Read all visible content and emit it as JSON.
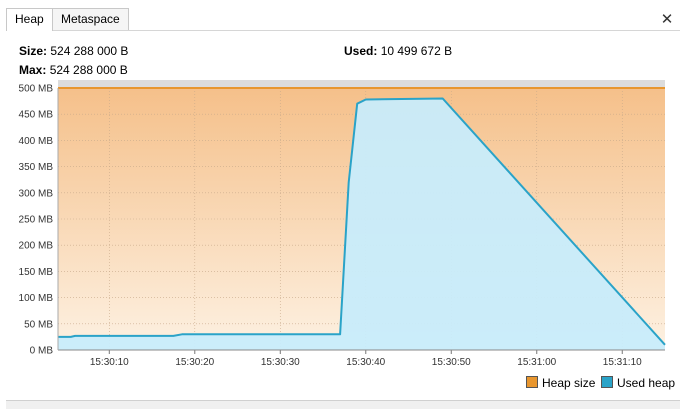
{
  "tabs": [
    {
      "label": "Heap",
      "active": true
    },
    {
      "label": "Metaspace",
      "active": false
    }
  ],
  "close_icon": "close-icon",
  "info": {
    "size_label": "Size:",
    "size_value": "524 288 000 B",
    "max_label": "Max:",
    "max_value": "524 288 000 B",
    "used_label": "Used:",
    "used_value": "10 499 672 B"
  },
  "colors": {
    "heap_size": "#e8962e",
    "used_heap": "#2aa3c8",
    "used_fill": "#c8ecfb",
    "plot_bg_top": "#f5c08a",
    "plot_bg_bottom": "#fdf1e2"
  },
  "chart_data": {
    "type": "area",
    "y_unit": "MB",
    "ylim": [
      0,
      500
    ],
    "x_range": [
      "15:30:04",
      "15:31:15"
    ],
    "y_ticks": [
      "0 MB",
      "50 MB",
      "100 MB",
      "150 MB",
      "200 MB",
      "250 MB",
      "300 MB",
      "350 MB",
      "400 MB",
      "450 MB",
      "500 MB"
    ],
    "x_ticks": [
      "15:30:10",
      "15:30:20",
      "15:30:30",
      "15:30:40",
      "15:30:50",
      "15:31:00",
      "15:31:10"
    ],
    "grid": true,
    "legend_position": "bottom-right",
    "series": [
      {
        "name": "Heap size",
        "points": [
          [
            "15:30:04",
            500
          ],
          [
            "15:31:15",
            500
          ]
        ]
      },
      {
        "name": "Used heap",
        "points": [
          [
            "15:30:04",
            25
          ],
          [
            "15:30:05.5",
            25
          ],
          [
            "15:30:06",
            27
          ],
          [
            "15:30:17.5",
            27
          ],
          [
            "15:30:18.5",
            30
          ],
          [
            "15:30:37",
            30
          ],
          [
            "15:30:38",
            320
          ],
          [
            "15:30:39",
            470
          ],
          [
            "15:30:40",
            478
          ],
          [
            "15:30:49",
            480
          ],
          [
            "15:31:15",
            10
          ]
        ]
      }
    ]
  }
}
